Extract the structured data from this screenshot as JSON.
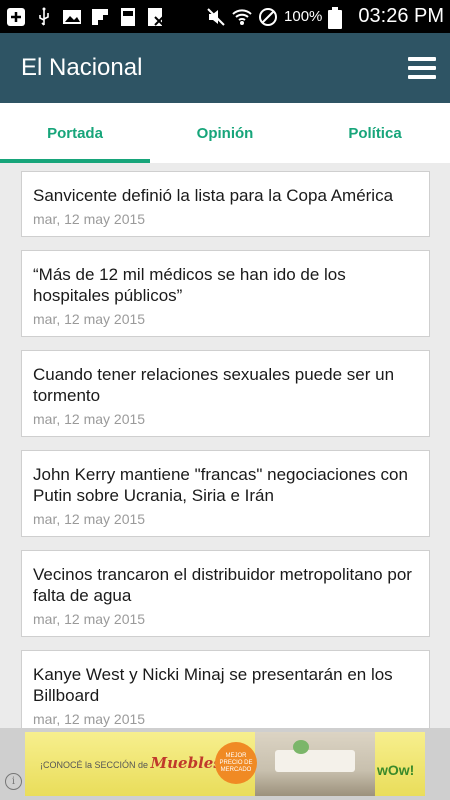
{
  "status_bar": {
    "battery_text": "100%",
    "clock": "03:26 PM"
  },
  "app_bar": {
    "title": "El Nacional"
  },
  "tabs": [
    {
      "label": "Portada",
      "active": true
    },
    {
      "label": "Opinión",
      "active": false
    },
    {
      "label": "Política",
      "active": false
    }
  ],
  "articles": [
    {
      "title": "Sanvicente definió la lista para la Copa América",
      "date": "mar, 12 may 2015"
    },
    {
      "title": "“Más de 12 mil médicos se han ido de los hospitales públicos”",
      "date": "mar, 12 may 2015"
    },
    {
      "title": "Cuando tener relaciones sexuales puede ser un tormento",
      "date": "mar, 12 may 2015"
    },
    {
      "title": "John Kerry mantiene \"francas\" negociaciones con Putin sobre Ucrania, Siria e Irán",
      "date": "mar, 12 may 2015"
    },
    {
      "title": "Vecinos trancaron el distribuidor metropolitano por falta de agua",
      "date": "mar, 12 may 2015"
    },
    {
      "title": "Kanye West y Nicki Minaj se presentarán en los Billboard",
      "date": "mar, 12 may 2015"
    }
  ],
  "ad": {
    "left_text": "¡CONOCÉ la SECCIÓN de",
    "left_highlight": "Muebles!",
    "badge_text": "MEJOR PRECIO DE MERCADO",
    "brand": "wOw!",
    "info_glyph": "i"
  },
  "colors": {
    "app_bar": "#2e5464",
    "accent": "#17a57a",
    "background": "#ebebeb"
  }
}
